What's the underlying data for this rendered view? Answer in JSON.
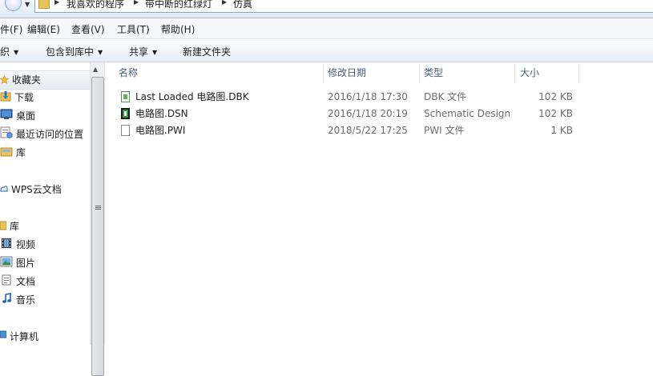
{
  "address_bar": {
    "crumbs": [
      "我喜欢的程序",
      "带中断的红绿灯",
      "仿真"
    ]
  },
  "menu": {
    "items": [
      "件(F)",
      "编辑(E)",
      "查看(V)",
      "工具(T)",
      "帮助(H)"
    ]
  },
  "toolbar": {
    "organize": "织",
    "include_in_library": "包含到库中",
    "share": "共享",
    "new_folder": "新建文件夹"
  },
  "nav": {
    "favorites": "收藏夹",
    "downloads": "下载",
    "desktop": "桌面",
    "recent": "最近访问的位置",
    "library_fav": "库",
    "wps_cloud": "WPS云文档",
    "libraries": "库",
    "videos": "视频",
    "pictures": "图片",
    "documents": "文档",
    "music": "音乐",
    "computer": "计算机"
  },
  "columns": {
    "name": "名称",
    "date": "修改日期",
    "type": "类型",
    "size": "大小"
  },
  "files": [
    {
      "name": "Last Loaded 电路图.DBK",
      "date": "2016/1/18 17:30",
      "type": "DBK 文件",
      "size": "102 KB"
    },
    {
      "name": "电路图.DSN",
      "date": "2016/1/18 20:19",
      "type": "Schematic Design",
      "size": "102 KB"
    },
    {
      "name": "电路图.PWI",
      "date": "2018/5/22 17:25",
      "type": "PWI 文件",
      "size": "1 KB"
    }
  ],
  "colors": {
    "folder": "#e8c559",
    "header_text": "#4c607a",
    "meta_text": "#6d6d6d"
  }
}
